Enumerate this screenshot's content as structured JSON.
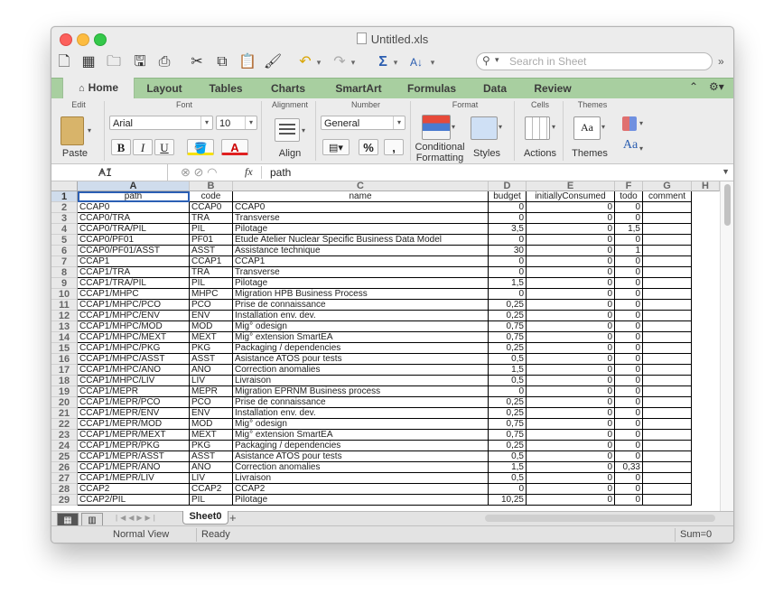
{
  "window": {
    "title": "Untitled.xls"
  },
  "search": {
    "placeholder": "Search in Sheet"
  },
  "tabs": [
    "Home",
    "Layout",
    "Tables",
    "Charts",
    "SmartArt",
    "Formulas",
    "Data",
    "Review"
  ],
  "ribbon": {
    "groups": {
      "edit": "Edit",
      "font": "Font",
      "alignment": "Alignment",
      "number": "Number",
      "format": "Format",
      "cells": "Cells",
      "themes": "Themes"
    },
    "paste_label": "Paste",
    "font_name": "Arial",
    "font_size": "10",
    "bold": "B",
    "italic": "I",
    "underline": "U",
    "align_label": "Align",
    "number_format": "General",
    "percent": "%",
    "comma": ",",
    "conditional_formatting": [
      "Conditional",
      "Formatting"
    ],
    "styles_label": "Styles",
    "actions_label": "Actions",
    "themes_label": "Themes",
    "themes_font_glyph": "Aa"
  },
  "formula_bar": {
    "cell_ref": "A1",
    "fx": "fx",
    "content": "path"
  },
  "columns": [
    "A",
    "B",
    "C",
    "D",
    "E",
    "F",
    "G",
    "H"
  ],
  "header_row": [
    "path",
    "code",
    "name",
    "budget",
    "initiallyConsumed",
    "todo",
    "comment"
  ],
  "rows": [
    [
      "CCAP0",
      "CCAP0",
      "CCAP0",
      "0",
      "0",
      "0",
      ""
    ],
    [
      "CCAP0/TRA",
      "TRA",
      "Transverse",
      "0",
      "0",
      "0",
      ""
    ],
    [
      "CCAP0/TRA/PIL",
      "PIL",
      "Pilotage",
      "3,5",
      "0",
      "1,5",
      ""
    ],
    [
      "CCAP0/PF01",
      "PF01",
      "Etude Atelier Nuclear Specific Business Data Model",
      "0",
      "0",
      "0",
      ""
    ],
    [
      "CCAP0/PF01/ASST",
      "ASST",
      "Assistance technique",
      "30",
      "0",
      "1",
      ""
    ],
    [
      "CCAP1",
      "CCAP1",
      "CCAP1",
      "0",
      "0",
      "0",
      ""
    ],
    [
      "CCAP1/TRA",
      "TRA",
      "Transverse",
      "0",
      "0",
      "0",
      ""
    ],
    [
      "CCAP1/TRA/PIL",
      "PIL",
      "Pilotage",
      "1,5",
      "0",
      "0",
      ""
    ],
    [
      "CCAP1/MHPC",
      "MHPC",
      "Migration HPB Business Process",
      "0",
      "0",
      "0",
      ""
    ],
    [
      "CCAP1/MHPC/PCO",
      "PCO",
      "Prise de connaissance",
      "0,25",
      "0",
      "0",
      ""
    ],
    [
      "CCAP1/MHPC/ENV",
      "ENV",
      "Installation env. dev.",
      "0,25",
      "0",
      "0",
      ""
    ],
    [
      "CCAP1/MHPC/MOD",
      "MOD",
      "Mig° odesign",
      "0,75",
      "0",
      "0",
      ""
    ],
    [
      "CCAP1/MHPC/MEXT",
      "MEXT",
      "Mig° extension SmartEA",
      "0,75",
      "0",
      "0",
      ""
    ],
    [
      "CCAP1/MHPC/PKG",
      "PKG",
      "Packaging / dependencies",
      "0,25",
      "0",
      "0",
      ""
    ],
    [
      "CCAP1/MHPC/ASST",
      "ASST",
      "Asistance ATOS pour tests",
      "0,5",
      "0",
      "0",
      ""
    ],
    [
      "CCAP1/MHPC/ANO",
      "ANO",
      "Correction anomalies",
      "1,5",
      "0",
      "0",
      ""
    ],
    [
      "CCAP1/MHPC/LIV",
      "LIV",
      "Livraison",
      "0,5",
      "0",
      "0",
      ""
    ],
    [
      "CCAP1/MEPR",
      "MEPR",
      "Migration EPRNM Business process",
      "0",
      "0",
      "0",
      ""
    ],
    [
      "CCAP1/MEPR/PCO",
      "PCO",
      "Prise de connaissance",
      "0,25",
      "0",
      "0",
      ""
    ],
    [
      "CCAP1/MEPR/ENV",
      "ENV",
      "Installation env. dev.",
      "0,25",
      "0",
      "0",
      ""
    ],
    [
      "CCAP1/MEPR/MOD",
      "MOD",
      "Mig° odesign",
      "0,75",
      "0",
      "0",
      ""
    ],
    [
      "CCAP1/MEPR/MEXT",
      "MEXT",
      "Mig° extension SmartEA",
      "0,75",
      "0",
      "0",
      ""
    ],
    [
      "CCAP1/MEPR/PKG",
      "PKG",
      "Packaging / dependencies",
      "0,25",
      "0",
      "0",
      ""
    ],
    [
      "CCAP1/MEPR/ASST",
      "ASST",
      "Asistance ATOS pour tests",
      "0,5",
      "0",
      "0",
      ""
    ],
    [
      "CCAP1/MEPR/ANO",
      "ANO",
      "Correction anomalies",
      "1,5",
      "0",
      "0,33",
      ""
    ],
    [
      "CCAP1/MEPR/LIV",
      "LIV",
      "Livraison",
      "0,5",
      "0",
      "0",
      ""
    ],
    [
      "CCAP2",
      "CCAP2",
      "CCAP2",
      "0",
      "0",
      "0",
      ""
    ],
    [
      "CCAP2/PIL",
      "PIL",
      "Pilotage",
      "10,25",
      "0",
      "0",
      ""
    ]
  ],
  "sheet_tab": "Sheet0",
  "add_sheet": "+",
  "status": {
    "view": "Normal View",
    "state": "Ready",
    "sum": "Sum=0"
  },
  "colors": {
    "ribbon_tabs": "#a8cfa0",
    "selection": "#2b5fb4",
    "header_selected": "#cfdcec"
  }
}
